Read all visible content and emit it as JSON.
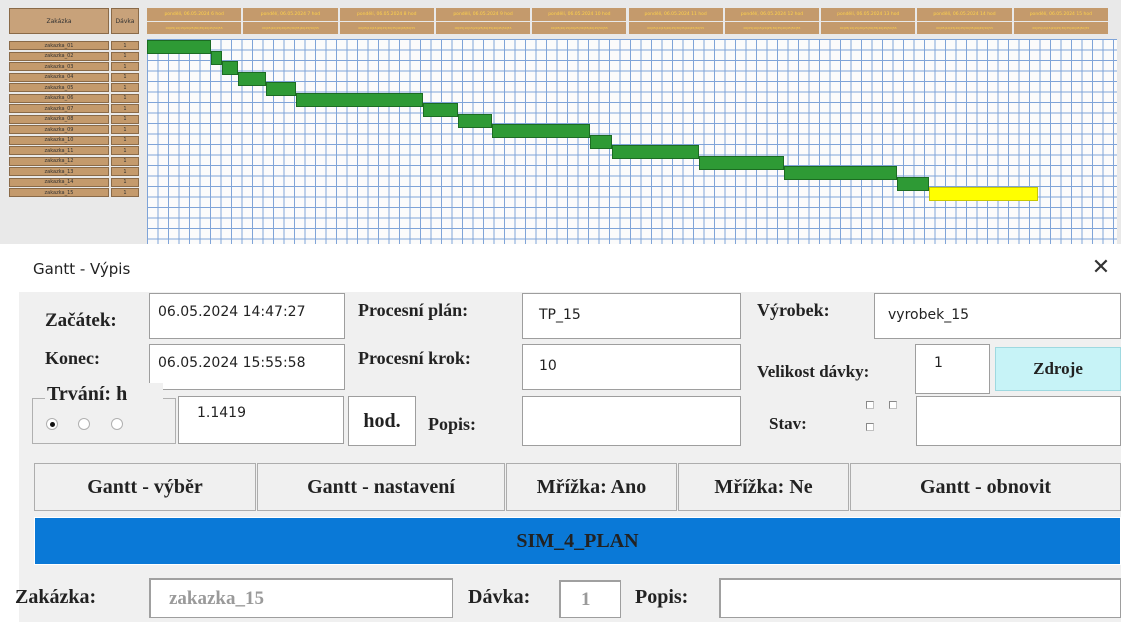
{
  "gantt": {
    "header_zakazka": "Zakázka",
    "header_davka": "Dávka",
    "hours": [
      {
        "label": "pondělí, 06.05.2024 6 hod",
        "minutes": "00|05|10|15|20|25|30|35|40|45|50|55"
      },
      {
        "label": "pondělí, 06.05.2024 7 hod",
        "minutes": "00|05|10|15|20|25|30|35|40|45|50|55"
      },
      {
        "label": "pondělí, 06.05.2024 8 hod",
        "minutes": "00|05|10|15|20|25|30|35|40|45|50|55"
      },
      {
        "label": "pondělí, 06.05.2024 9 hod",
        "minutes": "00|05|10|15|20|25|30|35|40|45|50|55"
      },
      {
        "label": "pondělí, 06.05.2024 10 hod",
        "minutes": "00|05|10|15|20|25|30|35|40|45|50|55"
      },
      {
        "label": "pondělí, 06.05.2024 11 hod",
        "minutes": "00|05|10|15|20|25|30|35|40|45|50|55"
      },
      {
        "label": "pondělí, 06.05.2024 12 hod",
        "minutes": "00|05|10|15|20|25|30|35|40|45|50|55"
      },
      {
        "label": "pondělí, 06.05.2024 13 hod",
        "minutes": "00|05|10|15|20|25|30|35|40|45|50|55"
      },
      {
        "label": "pondělí, 06.05.2024 14 hod",
        "minutes": "00|05|10|15|20|25|30|35|40|45|50|55"
      },
      {
        "label": "pondělí, 06.05.2024 15 hod",
        "minutes": "00|05|10|15|20|25|30|35|40|45|50|55"
      }
    ],
    "rows": [
      {
        "name": "zakazka_01",
        "davka": "1",
        "start_min": 0,
        "end_min": 40
      },
      {
        "name": "zakazka_02",
        "davka": "1",
        "start_min": 40,
        "end_min": 47
      },
      {
        "name": "zakazka_03",
        "davka": "1",
        "start_min": 47,
        "end_min": 57
      },
      {
        "name": "zakazka_04",
        "davka": "1",
        "start_min": 57,
        "end_min": 74
      },
      {
        "name": "zakazka_05",
        "davka": "1",
        "start_min": 74,
        "end_min": 93
      },
      {
        "name": "zakazka_06",
        "davka": "1",
        "start_min": 93,
        "end_min": 172
      },
      {
        "name": "zakazka_07",
        "davka": "1",
        "start_min": 172,
        "end_min": 194
      },
      {
        "name": "zakazka_08",
        "davka": "1",
        "start_min": 194,
        "end_min": 215
      },
      {
        "name": "zakazka_09",
        "davka": "1",
        "start_min": 215,
        "end_min": 276
      },
      {
        "name": "zakazka_10",
        "davka": "1",
        "start_min": 276,
        "end_min": 290
      },
      {
        "name": "zakazka_11",
        "davka": "1",
        "start_min": 290,
        "end_min": 344
      },
      {
        "name": "zakazka_12",
        "davka": "1",
        "start_min": 344,
        "end_min": 397
      },
      {
        "name": "zakazka_13",
        "davka": "1",
        "start_min": 397,
        "end_min": 467
      },
      {
        "name": "zakazka_14",
        "davka": "1",
        "start_min": 467,
        "end_min": 487
      },
      {
        "name": "zakazka_15",
        "davka": "1",
        "start_min": 487,
        "end_min": 555,
        "active": true
      }
    ]
  },
  "dialog": {
    "title": "Gantt - Výpis",
    "close": "✕",
    "labels": {
      "zacatek": "Začátek:",
      "konec": "Konec:",
      "trvani": "Trvání: h",
      "procesni_plan": "Procesní plán:",
      "procesni_krok": "Procesní krok:",
      "hod": "hod.",
      "popis": "Popis:",
      "vyrobek": "Výrobek:",
      "velikost_davky": "Velikost dávky:",
      "stav": "Stav:",
      "zakazka": "Zakázka:",
      "davka": "Dávka:",
      "popis2": "Popis:"
    },
    "values": {
      "zacatek": "06.05.2024 14:47:27",
      "konec": "06.05.2024 15:55:58",
      "trvani": "1.1419",
      "procesni_plan": "TP_15",
      "procesni_krok": "10",
      "popis": "",
      "vyrobek": "vyrobek_15",
      "velikost_davky": "1",
      "stav": "",
      "zakazka": "zakazka_15",
      "davka": "1",
      "popis2": ""
    },
    "buttons": {
      "zdroje": "Zdroje",
      "gantt_vyber": "Gantt - výběr",
      "gantt_nastaveni": "Gantt - nastavení",
      "mrizka_ano": "Mřížka: Ano",
      "mrizka_ne": "Mřížka: Ne",
      "gantt_obnovit": "Gantt - obnovit"
    },
    "banner": "SIM_4_PLAN",
    "trvani_unit_selected": 0
  },
  "colors": {
    "bar": "#2e9a35",
    "bar_active": "#ffff00",
    "banner": "#0a79d7",
    "zdroje": "#c7f3f7",
    "header": "#c49a6c"
  }
}
